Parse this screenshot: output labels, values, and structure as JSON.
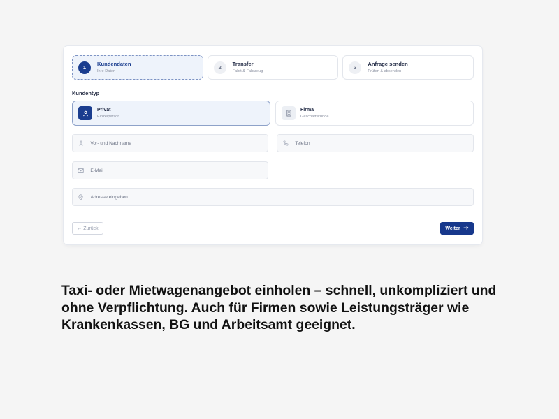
{
  "steps": [
    {
      "number": "1",
      "title": "Kundendaten",
      "subtitle": "Ihre Daten",
      "active": true
    },
    {
      "number": "2",
      "title": "Transfer",
      "subtitle": "Fahrt & Fahrzeug",
      "active": false
    },
    {
      "number": "3",
      "title": "Anfrage senden",
      "subtitle": "Prüfen & absenden",
      "active": false
    }
  ],
  "customer_type": {
    "label": "Kundentyp",
    "options": [
      {
        "title": "Privat",
        "subtitle": "Einzelperson",
        "icon": "person-icon",
        "selected": true
      },
      {
        "title": "Firma",
        "subtitle": "Geschäftskunde",
        "icon": "building-icon",
        "selected": false
      }
    ]
  },
  "fields": {
    "name": {
      "placeholder": "Vor- und Nachname",
      "value": "",
      "icon": "person-icon"
    },
    "phone": {
      "placeholder": "Telefon",
      "value": "",
      "icon": "phone-icon"
    },
    "email": {
      "placeholder": "E-Mail",
      "value": "",
      "icon": "mail-icon"
    },
    "address": {
      "placeholder": "Adresse eingeben",
      "value": "",
      "icon": "location-pin-icon"
    }
  },
  "buttons": {
    "back": "← Zurück",
    "next": "Weiter"
  },
  "colors": {
    "accent": "#17388c",
    "active_bg": "#eef3fb"
  },
  "caption": "Taxi- oder Mietwagenangebot einholen – schnell, unkompliziert und ohne Verpflichtung. Auch für Firmen sowie Leistungsträger wie Krankenkassen, BG und Arbeitsamt geeignet."
}
